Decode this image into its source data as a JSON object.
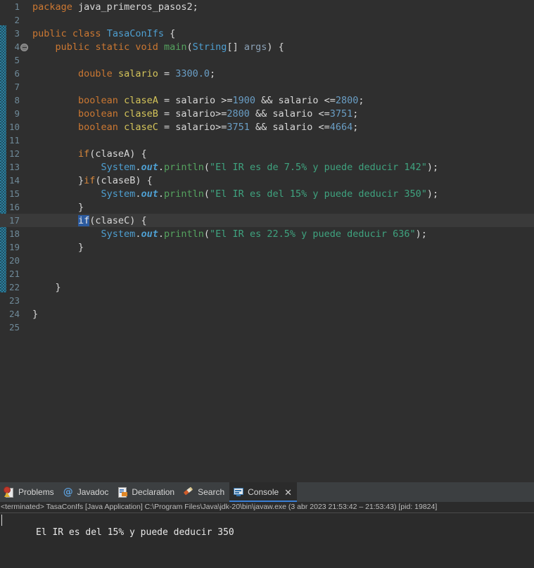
{
  "editor": {
    "language": "java",
    "current_line": 17,
    "fold_marker_line": 4,
    "lines": [
      {
        "n": 1,
        "tokens": [
          {
            "t": "package",
            "c": "kw"
          },
          {
            "t": " ",
            "c": "plain"
          },
          {
            "t": "java_primeros_pasos2",
            "c": "plain"
          },
          {
            "t": ";",
            "c": "plain"
          }
        ]
      },
      {
        "n": 2,
        "tokens": []
      },
      {
        "n": 3,
        "tokens": [
          {
            "t": "public",
            "c": "kw"
          },
          {
            "t": " ",
            "c": "plain"
          },
          {
            "t": "class",
            "c": "kw"
          },
          {
            "t": " ",
            "c": "plain"
          },
          {
            "t": "TasaConIfs",
            "c": "cls"
          },
          {
            "t": " {",
            "c": "plain"
          }
        ]
      },
      {
        "n": 4,
        "tokens": [
          {
            "t": "    ",
            "c": "plain"
          },
          {
            "t": "public",
            "c": "kw"
          },
          {
            "t": " ",
            "c": "plain"
          },
          {
            "t": "static",
            "c": "kw"
          },
          {
            "t": " ",
            "c": "plain"
          },
          {
            "t": "void",
            "c": "kw"
          },
          {
            "t": " ",
            "c": "plain"
          },
          {
            "t": "main",
            "c": "fn"
          },
          {
            "t": "(",
            "c": "plain"
          },
          {
            "t": "String",
            "c": "type"
          },
          {
            "t": "[] ",
            "c": "plain"
          },
          {
            "t": "args",
            "c": "param"
          },
          {
            "t": ") {",
            "c": "plain"
          }
        ]
      },
      {
        "n": 5,
        "tokens": []
      },
      {
        "n": 6,
        "tokens": [
          {
            "t": "        ",
            "c": "plain"
          },
          {
            "t": "double",
            "c": "kw"
          },
          {
            "t": " ",
            "c": "plain"
          },
          {
            "t": "salario",
            "c": "var"
          },
          {
            "t": " = ",
            "c": "plain"
          },
          {
            "t": "3300.0",
            "c": "num"
          },
          {
            "t": ";",
            "c": "plain"
          }
        ]
      },
      {
        "n": 7,
        "tokens": []
      },
      {
        "n": 8,
        "tokens": [
          {
            "t": "        ",
            "c": "plain"
          },
          {
            "t": "boolean",
            "c": "kw"
          },
          {
            "t": " ",
            "c": "plain"
          },
          {
            "t": "claseA",
            "c": "var"
          },
          {
            "t": " = salario >=",
            "c": "plain"
          },
          {
            "t": "1900",
            "c": "num"
          },
          {
            "t": " && salario <=",
            "c": "plain"
          },
          {
            "t": "2800",
            "c": "num"
          },
          {
            "t": ";",
            "c": "plain"
          }
        ]
      },
      {
        "n": 9,
        "tokens": [
          {
            "t": "        ",
            "c": "plain"
          },
          {
            "t": "boolean",
            "c": "kw"
          },
          {
            "t": " ",
            "c": "plain"
          },
          {
            "t": "claseB",
            "c": "var"
          },
          {
            "t": " = salario>=",
            "c": "plain"
          },
          {
            "t": "2800",
            "c": "num"
          },
          {
            "t": " && salario <=",
            "c": "plain"
          },
          {
            "t": "3751",
            "c": "num"
          },
          {
            "t": ";",
            "c": "plain"
          }
        ]
      },
      {
        "n": 10,
        "tokens": [
          {
            "t": "        ",
            "c": "plain"
          },
          {
            "t": "boolean",
            "c": "kw"
          },
          {
            "t": " ",
            "c": "plain"
          },
          {
            "t": "claseC",
            "c": "var"
          },
          {
            "t": " = salario>=",
            "c": "plain"
          },
          {
            "t": "3751",
            "c": "num"
          },
          {
            "t": " && salario <=",
            "c": "plain"
          },
          {
            "t": "4664",
            "c": "num"
          },
          {
            "t": ";",
            "c": "plain"
          }
        ]
      },
      {
        "n": 11,
        "tokens": []
      },
      {
        "n": 12,
        "tokens": [
          {
            "t": "        ",
            "c": "plain"
          },
          {
            "t": "if",
            "c": "kw2"
          },
          {
            "t": "(claseA) {",
            "c": "plain"
          }
        ]
      },
      {
        "n": 13,
        "tokens": [
          {
            "t": "            ",
            "c": "plain"
          },
          {
            "t": "System",
            "c": "type"
          },
          {
            "t": ".",
            "c": "plain"
          },
          {
            "t": "out",
            "c": "field"
          },
          {
            "t": ".",
            "c": "plain"
          },
          {
            "t": "println",
            "c": "fn"
          },
          {
            "t": "(",
            "c": "plain"
          },
          {
            "t": "\"El IR es de 7.5% y puede deducir 142\"",
            "c": "str"
          },
          {
            "t": ");",
            "c": "plain"
          }
        ]
      },
      {
        "n": 14,
        "tokens": [
          {
            "t": "        }",
            "c": "plain"
          },
          {
            "t": "if",
            "c": "kw2"
          },
          {
            "t": "(claseB) {",
            "c": "plain"
          }
        ]
      },
      {
        "n": 15,
        "tokens": [
          {
            "t": "            ",
            "c": "plain"
          },
          {
            "t": "System",
            "c": "type"
          },
          {
            "t": ".",
            "c": "plain"
          },
          {
            "t": "out",
            "c": "field"
          },
          {
            "t": ".",
            "c": "plain"
          },
          {
            "t": "println",
            "c": "fn"
          },
          {
            "t": "(",
            "c": "plain"
          },
          {
            "t": "\"El IR es del 15% y puede deducir 350\"",
            "c": "str"
          },
          {
            "t": ");",
            "c": "plain"
          }
        ]
      },
      {
        "n": 16,
        "tokens": [
          {
            "t": "        }",
            "c": "plain"
          }
        ]
      },
      {
        "n": 17,
        "tokens": [
          {
            "t": "        ",
            "c": "plain"
          },
          {
            "t": "if",
            "c": "sel"
          },
          {
            "t": "(claseC) {",
            "c": "plain"
          }
        ]
      },
      {
        "n": 18,
        "tokens": [
          {
            "t": "            ",
            "c": "plain"
          },
          {
            "t": "System",
            "c": "type"
          },
          {
            "t": ".",
            "c": "plain"
          },
          {
            "t": "out",
            "c": "field"
          },
          {
            "t": ".",
            "c": "plain"
          },
          {
            "t": "println",
            "c": "fn"
          },
          {
            "t": "(",
            "c": "plain"
          },
          {
            "t": "\"El IR es 22.5% y puede deducir 636\"",
            "c": "str"
          },
          {
            "t": ");",
            "c": "plain"
          }
        ]
      },
      {
        "n": 19,
        "tokens": [
          {
            "t": "        }",
            "c": "plain"
          }
        ]
      },
      {
        "n": 20,
        "tokens": []
      },
      {
        "n": 21,
        "tokens": []
      },
      {
        "n": 22,
        "tokens": [
          {
            "t": "    }",
            "c": "plain"
          }
        ]
      },
      {
        "n": 23,
        "tokens": []
      },
      {
        "n": 24,
        "tokens": [
          {
            "t": "}",
            "c": "plain"
          }
        ]
      },
      {
        "n": 25,
        "tokens": []
      }
    ]
  },
  "scrollbar": {
    "left_arrow": "«"
  },
  "panel": {
    "tabs": [
      {
        "label": "Problems",
        "icon": "problems-icon",
        "active": false,
        "closable": false
      },
      {
        "label": "Javadoc",
        "icon": "javadoc-at-icon",
        "active": false,
        "closable": false
      },
      {
        "label": "Declaration",
        "icon": "declaration-icon",
        "active": false,
        "closable": false
      },
      {
        "label": "Search",
        "icon": "search-pencil-icon",
        "active": false,
        "closable": false
      },
      {
        "label": "Console",
        "icon": "console-monitor-icon",
        "active": true,
        "closable": true
      }
    ],
    "close_glyph": "✕",
    "console": {
      "header": "<terminated> TasaConIfs [Java Application] C:\\Program Files\\Java\\jdk-20\\bin\\javaw.exe  (3 abr 2023 21:53:42 – 21:53:43) [pid: 19824]",
      "output": "El IR es del 15% y puede deducir 350"
    }
  },
  "colors": {
    "editor_bg": "#2f2f2f",
    "panel_bg": "#3c3f41",
    "console_bg": "#2b2b2b",
    "keyword": "#cc7832",
    "type": "#4e9fd1",
    "method": "#55a35f",
    "variable": "#d4c45a",
    "number": "#6a9ec5",
    "string": "#3fa37f",
    "line_number": "#6f8a99",
    "active_tab_underline": "#3a7fd5",
    "selection": "#2c5ba0",
    "change_bar": "#2d7f9d"
  }
}
